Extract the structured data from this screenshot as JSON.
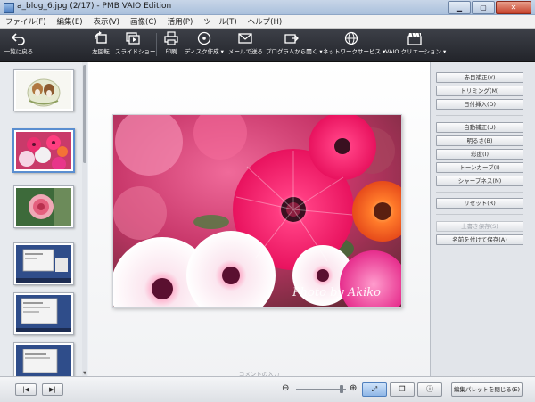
{
  "window": {
    "title": "a_blog_6.jpg (2/17) - PMB VAIO Edition"
  },
  "menu": [
    {
      "id": "file",
      "label": "ファイル(F)"
    },
    {
      "id": "edit",
      "label": "編集(E)"
    },
    {
      "id": "view",
      "label": "表示(V)"
    },
    {
      "id": "image",
      "label": "画像(C)"
    },
    {
      "id": "use",
      "label": "活用(P)"
    },
    {
      "id": "tools",
      "label": "ツール(T)"
    },
    {
      "id": "help",
      "label": "ヘルプ(H)"
    }
  ],
  "toolbar": {
    "back": "一覧に戻る",
    "rotate_left": "左回転",
    "slideshow": "スライドショー",
    "print": "印刷",
    "disc": "ディスク作成",
    "mail": "メールで送る",
    "open_with": "プログラムから開く",
    "network": "ネットワークサービス",
    "vaio_creation": "VAIO クリエーション"
  },
  "icons": {
    "dropdown": "▾",
    "scroll_down": "▼",
    "first": "|◀",
    "last": "▶|",
    "zoom_out": "⊖",
    "zoom_in": "⊕",
    "fit": "⤢",
    "compare": "❐",
    "info": "ⓘ"
  },
  "right_panel": {
    "red_eye": "赤目補正(Y)",
    "trimming": "トリミング(M)",
    "date_insert": "日付挿入(D)",
    "auto_correct": "自動補正(U)",
    "brightness": "明るさ(B)",
    "saturation": "彩度(I)",
    "tone_curve": "トーンカーブ(I)",
    "sharpness": "シャープネス(N)",
    "reset": "リセット(R)",
    "overwrite_save": "上書き保存(S)",
    "save_as": "名前を付けて保存(A)"
  },
  "main": {
    "comment_hint": "コメントの入力",
    "watermark": "Photo by Akiko"
  },
  "bottom": {
    "close_palette": "編集パレットを閉じる(E)"
  },
  "colors": {
    "toolbar_bg": "#2b2d33",
    "selected_border": "#5a8ed0",
    "photo_pink": "#e8256a",
    "photo_orange": "#f26a2a"
  }
}
